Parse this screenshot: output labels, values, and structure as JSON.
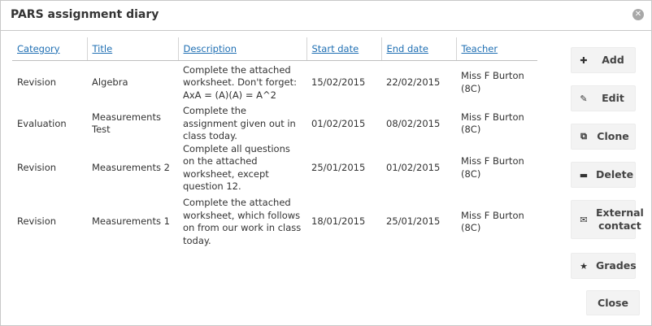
{
  "window": {
    "title": "PARS assignment diary",
    "close_glyph": "✕"
  },
  "table": {
    "headers": {
      "category": "Category",
      "title": "Title",
      "description": "Description",
      "start_date": "Start date",
      "end_date": "End date",
      "teacher": "Teacher"
    },
    "rows": [
      {
        "category": "Revision",
        "title": "Algebra",
        "description": "Complete the attached worksheet. Don't forget: AxA = (A)(A) = A^2",
        "start_date": "15/02/2015",
        "end_date": "22/02/2015",
        "teacher": "Miss F Burton (8C)"
      },
      {
        "category": "Evaluation",
        "title": "Measurements Test",
        "description": "Complete the assignment given out in class today.",
        "start_date": "01/02/2015",
        "end_date": "08/02/2015",
        "teacher": "Miss F Burton (8C)"
      },
      {
        "category": "Revision",
        "title": "Measurements 2",
        "description": "Complete all questions on the attached worksheet, except question 12.",
        "start_date": "25/01/2015",
        "end_date": "01/02/2015",
        "teacher": "Miss F Burton (8C)"
      },
      {
        "category": "Revision",
        "title": "Measurements 1",
        "description": "Complete the attached worksheet, which follows on from our work in class today.",
        "start_date": "18/01/2015",
        "end_date": "25/01/2015",
        "teacher": "Miss F Burton (8C)"
      }
    ]
  },
  "actions": {
    "add": {
      "label": "Add",
      "icon": "plus-icon",
      "glyph": "✚"
    },
    "edit": {
      "label": "Edit",
      "icon": "pencil-icon",
      "glyph": "✎"
    },
    "clone": {
      "label": "Clone",
      "icon": "copy-icon",
      "glyph": "⧉"
    },
    "delete": {
      "label": "Delete",
      "icon": "minus-icon",
      "glyph": "▬"
    },
    "external_contact": {
      "label": "External contact",
      "icon": "envelope-icon",
      "glyph": "✉"
    },
    "grades": {
      "label": "Grades",
      "icon": "star-icon",
      "glyph": "★"
    }
  },
  "footer": {
    "close_label": "Close"
  },
  "colors": {
    "link": "#1f6fb3",
    "button_bg": "#f3f3f3",
    "border": "#c8c8c8"
  }
}
